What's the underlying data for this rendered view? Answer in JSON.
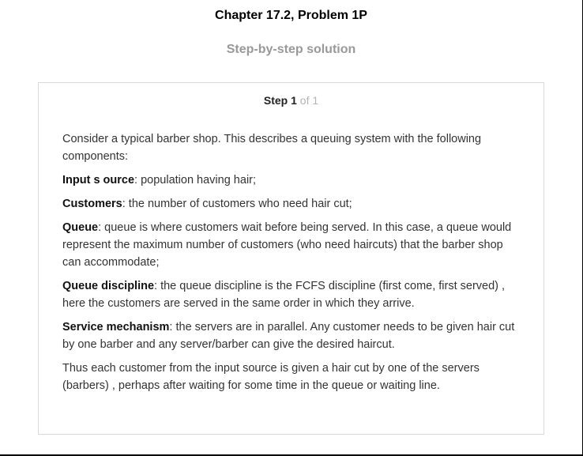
{
  "header": {
    "title": "Chapter 17.2, Problem 1P",
    "subtitle": "Step-by-step solution"
  },
  "step": {
    "label": "Step",
    "number": "1",
    "of_total": "of 1"
  },
  "content": {
    "intro": "Consider a typical barber shop. This describes a queuing system with the following components:",
    "items": [
      {
        "term": "Input s ource",
        "text": ": population having hair;"
      },
      {
        "term": "Customers",
        "text": ": the number of customers who need hair cut;"
      },
      {
        "term": "Queue",
        "text": ": queue is where customers wait before being served. In this case, a queue would represent the maximum number of customers (who need haircuts) that the barber shop can accommodate;"
      },
      {
        "term": "Queue discipline",
        "text": ": the queue discipline is the FCFS discipline (first come, first served) , here the customers are served in the same order in which they arrive."
      },
      {
        "term": "Service mechanism",
        "text": ": the servers are in parallel. Any customer needs to be given hair cut by one barber and any server/barber can give the desired haircut."
      }
    ],
    "conclusion": "Thus each customer from the input source is given a hair cut by one of the servers (barbers) , perhaps after waiting for some time in the queue or waiting line."
  }
}
